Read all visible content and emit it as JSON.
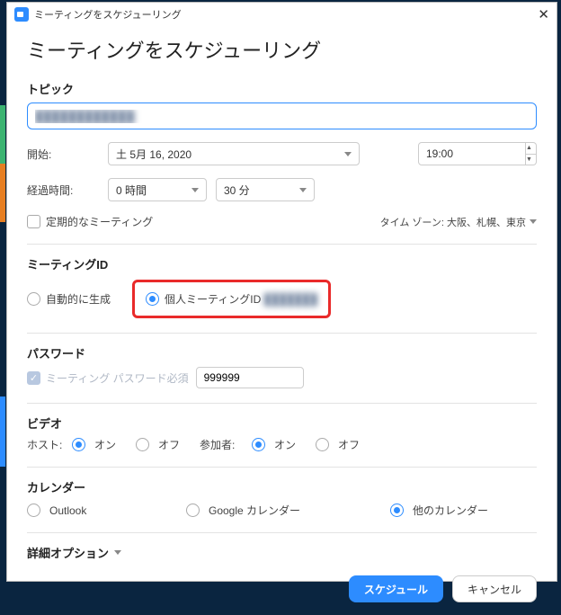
{
  "window": {
    "title": "ミーティングをスケジューリング"
  },
  "page": {
    "title": "ミーティングをスケジューリング"
  },
  "topic": {
    "label": "トピック",
    "value": "████████████"
  },
  "start": {
    "label": "開始:",
    "date": "土  5月 16, 2020",
    "time": "19:00"
  },
  "duration": {
    "label": "経過時間:",
    "hours": "0 時間",
    "minutes": "30 分"
  },
  "recurring": {
    "label": "定期的なミーティング",
    "checked": false
  },
  "timezone": {
    "label": "タイム ゾーン: 大阪、札幌、東京"
  },
  "meeting_id": {
    "header": "ミーティングID",
    "auto": "自動的に生成",
    "personal": "個人ミーティングID",
    "personal_value": "███████",
    "selected": "personal"
  },
  "password": {
    "header": "パスワード",
    "require_label": "ミーティング パスワード必須",
    "value": "999999"
  },
  "video": {
    "header": "ビデオ",
    "host_label": "ホスト:",
    "participant_label": "参加者:",
    "on": "オン",
    "off": "オフ"
  },
  "calendar": {
    "header": "カレンダー",
    "outlook": "Outlook",
    "google": "Google カレンダー",
    "other": "他のカレンダー"
  },
  "advanced": {
    "label": "詳細オプション"
  },
  "buttons": {
    "schedule": "スケジュール",
    "cancel": "キャンセル"
  }
}
